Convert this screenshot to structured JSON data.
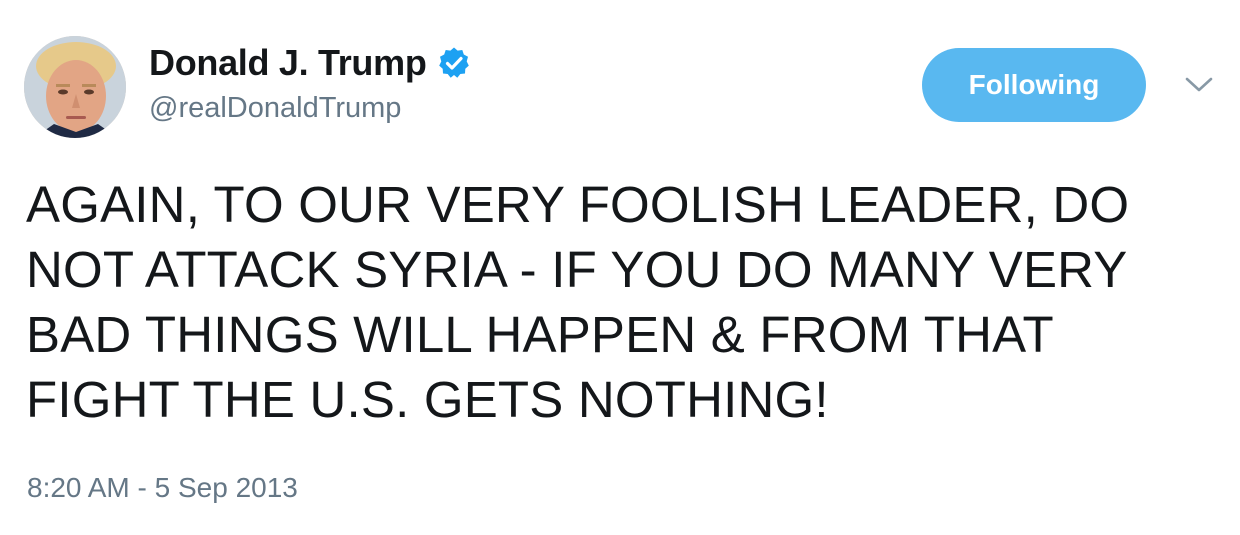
{
  "user": {
    "display_name": "Donald J. Trump",
    "handle": "@realDonaldTrump",
    "verified": true,
    "avatar_icon": "profile-photo"
  },
  "follow_button": {
    "label": "Following"
  },
  "menu": {
    "icon": "chevron-down-icon"
  },
  "tweet": {
    "text": "AGAIN, TO OUR VERY FOOLISH LEADER, DO NOT ATTACK SYRIA - IF YOU DO MANY VERY BAD THINGS WILL HAPPEN & FROM THAT FIGHT THE U.S. GETS NOTHING!",
    "timestamp": "8:20 AM - 5 Sep 2013"
  },
  "colors": {
    "accent": "#1da1f2",
    "button": "#59b8f0",
    "text": "#14171a",
    "secondary_text": "#657786"
  }
}
